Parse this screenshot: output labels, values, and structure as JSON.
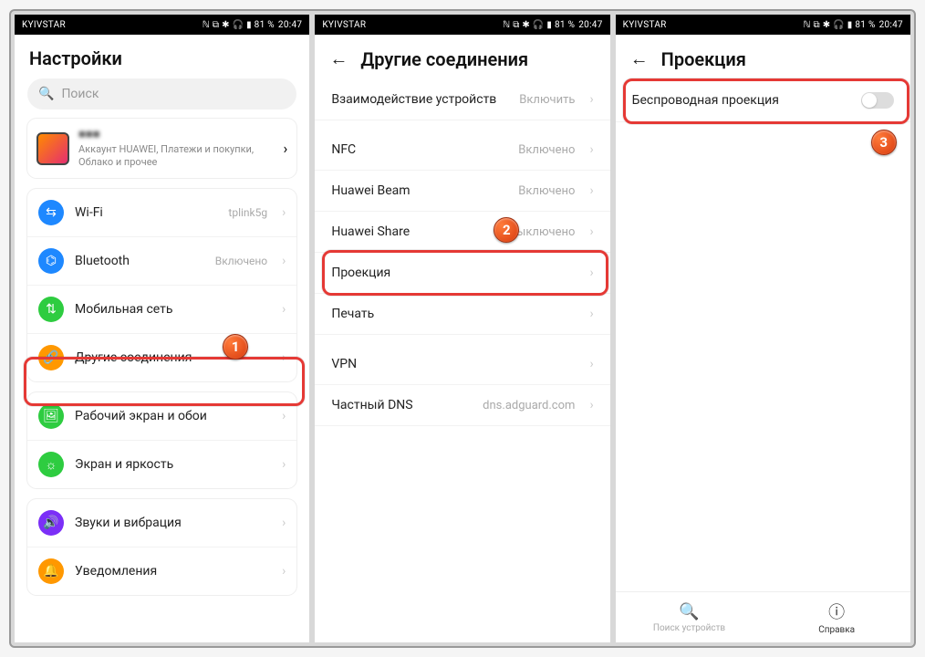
{
  "statusbar": {
    "carrier": "KYIVSTAR",
    "indicators": "ℕ ⧉ ✱ 🎧 ▮ 81 %",
    "time": "20:47"
  },
  "screen1": {
    "title": "Настройки",
    "search_placeholder": "Поиск",
    "account_name": "■■■",
    "account_sub": "Аккаунт HUAWEI, Платежи и покупки, Облако и прочее",
    "rows": {
      "wifi": {
        "label": "Wi-Fi",
        "value": "tplink5g"
      },
      "bt": {
        "label": "Bluetooth",
        "value": "Включено"
      },
      "mobile": {
        "label": "Мобильная сеть",
        "value": ""
      },
      "other": {
        "label": "Другие соединения",
        "value": ""
      },
      "wall": {
        "label": "Рабочий экран и обои",
        "value": ""
      },
      "bright": {
        "label": "Экран и яркость",
        "value": ""
      },
      "sound": {
        "label": "Звуки и вибрация",
        "value": ""
      },
      "notif": {
        "label": "Уведомления",
        "value": ""
      }
    },
    "badge": "1"
  },
  "screen2": {
    "title": "Другие соединения",
    "rows": {
      "interact": {
        "label": "Взаимодействие устройств",
        "value": "Включить"
      },
      "nfc": {
        "label": "NFC",
        "value": "Включено"
      },
      "beam": {
        "label": "Huawei Beam",
        "value": "Включено"
      },
      "share": {
        "label": "Huawei Share",
        "value": "Выключено"
      },
      "proj": {
        "label": "Проекция",
        "value": ""
      },
      "print": {
        "label": "Печать",
        "value": ""
      },
      "vpn": {
        "label": "VPN",
        "value": ""
      },
      "dns": {
        "label": "Частный DNS",
        "value": "dns.adguard.com"
      }
    },
    "badge": "2"
  },
  "screen3": {
    "title": "Проекция",
    "wireless": "Беспроводная проекция",
    "tabs": {
      "search": "Поиск устройств",
      "help": "Справка"
    },
    "badge": "3"
  }
}
